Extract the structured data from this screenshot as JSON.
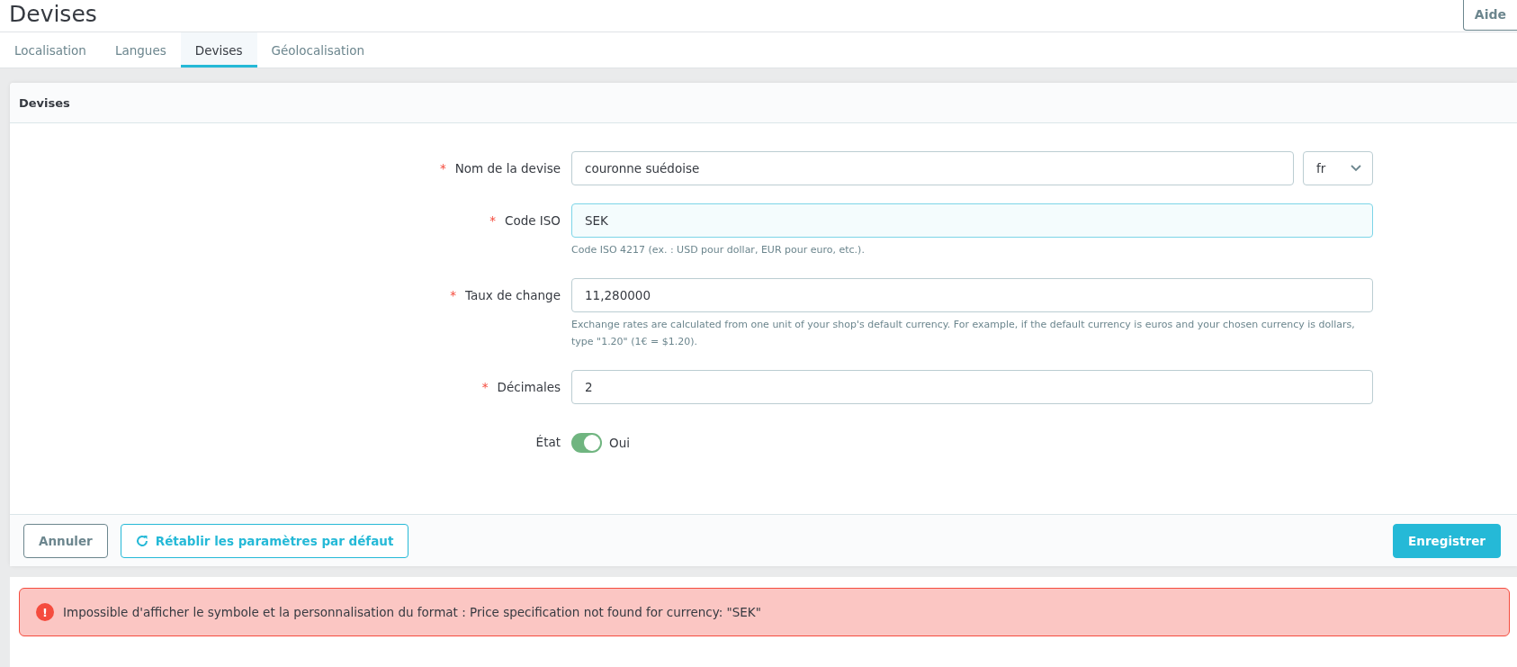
{
  "page_title": "Devises",
  "help_button": "Aide",
  "tabs": [
    {
      "label": "Localisation",
      "selected": false
    },
    {
      "label": "Langues",
      "selected": false
    },
    {
      "label": "Devises",
      "selected": true
    },
    {
      "label": "Géolocalisation",
      "selected": false
    }
  ],
  "panel": {
    "title": "Devises",
    "fields": [
      {
        "kind": "text",
        "label": "Nom de la devise",
        "required": "*",
        "value": "couronne suédoise",
        "focused": false,
        "language": "fr"
      },
      {
        "kind": "text",
        "label": "Code ISO",
        "required": "*",
        "value": "SEK",
        "focused": true,
        "help": "Code ISO 4217 (ex. : USD pour dollar, EUR pour euro, etc.)."
      },
      {
        "kind": "text",
        "label": "Taux de change",
        "required": "*",
        "value": "11,280000",
        "focused": false,
        "help": "Exchange rates are calculated from one unit of your shop's default currency. For example, if the default currency is euros and your chosen currency is dollars, type \"1.20\" (1€ = $1.20)."
      },
      {
        "kind": "text",
        "label": "Décimales",
        "required": "*",
        "value": "2",
        "focused": false
      },
      {
        "kind": "switch",
        "label": "État",
        "on": true,
        "value": "Oui"
      }
    ],
    "footer": {
      "cancel": "Annuler",
      "reset": "Rétablir les paramètres par défaut",
      "save": "Enregistrer"
    }
  },
  "alert": {
    "icon": "!",
    "message": "Impossible d'afficher le symbole et la personnalisation du format : Price specification not found for currency: \"SEK\""
  }
}
